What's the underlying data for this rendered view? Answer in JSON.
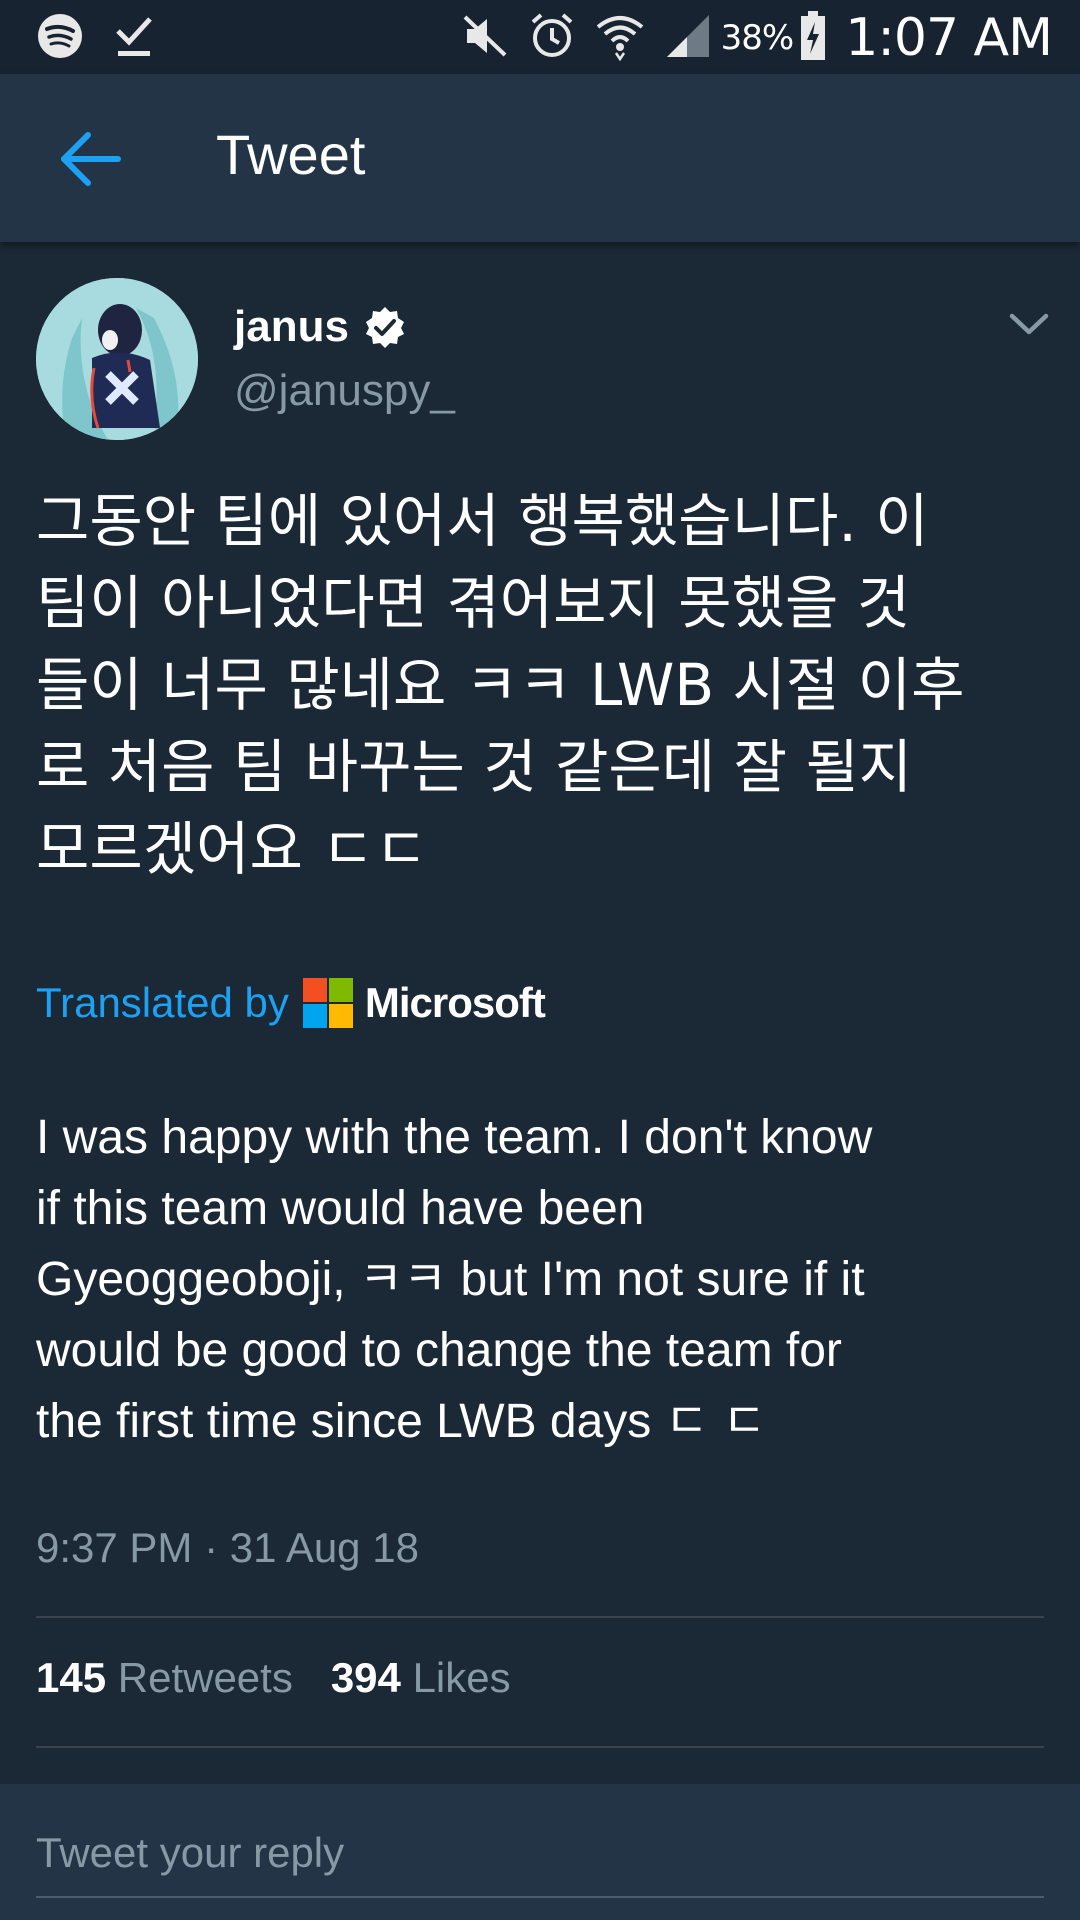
{
  "status_bar": {
    "battery_percent": "38%",
    "time": "1:07 AM",
    "icons": [
      "spotify-icon",
      "download-done-icon",
      "mute-icon",
      "alarm-icon",
      "wifi-icon",
      "signal-icon",
      "battery-charging-icon"
    ]
  },
  "app_bar": {
    "title": "Tweet",
    "back_icon": "arrow-left-icon"
  },
  "tweet": {
    "author_name": "janus",
    "author_handle": "@januspy_",
    "verified": true,
    "text": "그동안 팀에 있어서 행복했습니다. 이\n팀이 아니었다면 겪어보지 못했을 것\n들이 너무 많네요 ㅋㅋ LWB 시절 이후\n로 처음 팀 바꾸는 것 같은데 잘 될지\n모르겠어요 ㄷㄷ",
    "translated_by_label": "Translated by",
    "translator_name": "Microsoft",
    "translation": "I was happy with the team. I don't know\nif this team would have been\nGyeoggeoboji, ㅋㅋ but I'm not sure if it\nwould be good to change the team for\nthe first time since LWB days ㄷ ㄷ",
    "timestamp": "9:37 PM · 31 Aug 18",
    "retweets_count": "145",
    "retweets_label": "Retweets",
    "likes_count": "394",
    "likes_label": "Likes"
  },
  "reply": {
    "placeholder": "Tweet your reply"
  },
  "colors": {
    "background": "#1b2836",
    "app_bar": "#243447",
    "accent": "#1da1f2",
    "secondary_text": "#8899a6"
  }
}
